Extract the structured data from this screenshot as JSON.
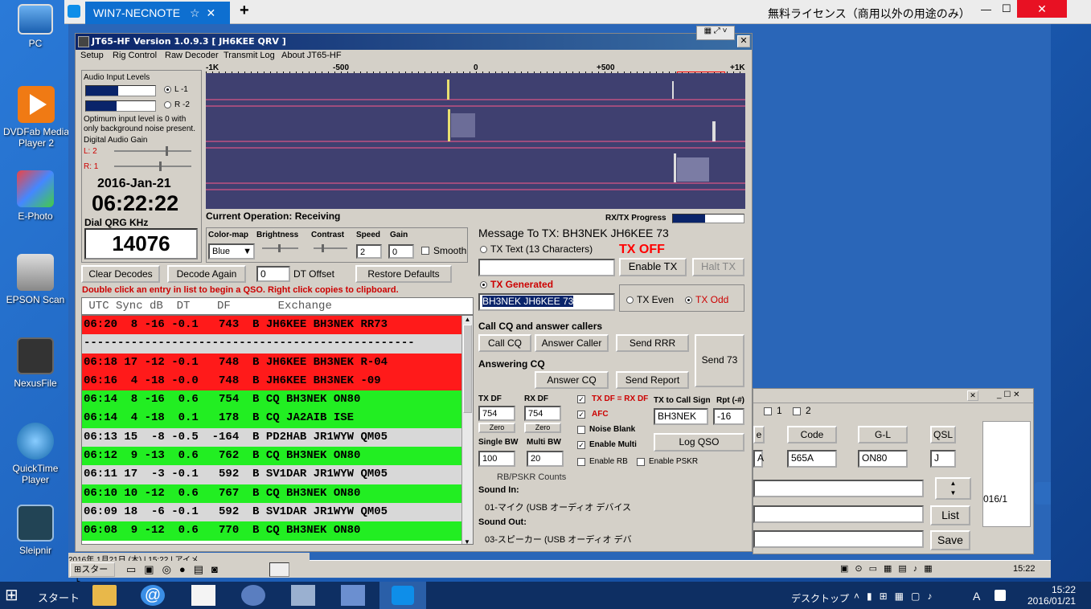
{
  "desktop_icons": [
    {
      "label": "PC",
      "icon": "pc-icon"
    },
    {
      "label": "DVDFab Media Player 2",
      "icon": "dvdfab-icon"
    },
    {
      "label": "E-Photo",
      "icon": "ephoto-icon"
    },
    {
      "label": "EPSON Scan",
      "icon": "epson-scan-icon"
    },
    {
      "label": "NexusFile",
      "icon": "nexusfile-icon"
    },
    {
      "label": "QuickTime Player",
      "icon": "quicktime-icon"
    },
    {
      "label": "Sleipnir",
      "icon": "sleipnir-icon"
    }
  ],
  "tv": {
    "tab": "WIN7-NECNOTE",
    "license": "無料ライセンス（商用以外の用途のみ）"
  },
  "jt": {
    "title": "JT65-HF Version 1.0.9.3  [ JH6KEE QRV ]",
    "menu": [
      "Setup",
      "Rig Control",
      "Raw Decoder",
      "Transmit Log",
      "About JT65-HF"
    ],
    "audio_label": "Audio Input Levels",
    "ch_left": "L -1",
    "ch_right": "R -2",
    "optimum_text": "Optimum input level is 0 with only background noise present.",
    "digital_gain": "Digital Audio Gain",
    "l_gain": "L: 2",
    "r_gain": "R: 1",
    "date": "2016-Jan-21",
    "time": "06:22:22",
    "dial_label": "Dial QRG KHz",
    "dial_value": "14076",
    "scale": [
      "-1K",
      "-500",
      "0",
      "+500",
      "+1K"
    ],
    "current_op_label": "Current Operation:",
    "current_op": "Receiving",
    "progress_label": "RX/TX Progress",
    "progress_value": 0.45,
    "colormap_label": "Color-map",
    "colormap_value": "Blue",
    "brightness_label": "Brightness",
    "contrast_label": "Contrast",
    "speed_label": "Speed",
    "speed_value": "2",
    "gain_label": "Gain",
    "gain_value": "0",
    "smooth_label": "Smooth",
    "clear_decodes": "Clear Decodes",
    "decode_again": "Decode Again",
    "dt_offset_value": "0",
    "dt_offset_label": "DT Offset",
    "restore_defaults": "Restore Defaults",
    "hint": "Double click an entry in list to begin a QSO.  Right click copies to clipboard.",
    "decode_header": " UTC Sync dB  DT    DF       Exchange",
    "decodes": [
      {
        "text": "06:20  8 -16 -0.1   743  B JH6KEE BH3NEK RR73",
        "bg": "#ff1a1a"
      },
      {
        "text": "-------------------------------------------------",
        "bg": "#d8d8d8"
      },
      {
        "text": "06:18 17 -12 -0.1   748  B JH6KEE BH3NEK R-04",
        "bg": "#ff1a1a"
      },
      {
        "text": "06:16  4 -18 -0.0   748  B JH6KEE BH3NEK -09",
        "bg": "#ff1a1a"
      },
      {
        "text": "06:14  8 -16  0.6   754  B CQ BH3NEK ON80",
        "bg": "#22ee22"
      },
      {
        "text": "06:14  4 -18  0.1   178  B CQ JA2AIB ISE",
        "bg": "#22ee22"
      },
      {
        "text": "06:13 15  -8 -0.5  -164  B PD2HAB JR1WYW QM05",
        "bg": "#d8d8d8"
      },
      {
        "text": "06:12  9 -13  0.6   762  B CQ BH3NEK ON80",
        "bg": "#22ee22"
      },
      {
        "text": "06:11 17  -3 -0.1   592  B SV1DAR JR1WYW QM05",
        "bg": "#d8d8d8"
      },
      {
        "text": "06:10 10 -12  0.6   767  B CQ BH3NEK ON80",
        "bg": "#22ee22"
      },
      {
        "text": "06:09 18  -6 -0.1   592  B SV1DAR JR1WYW QM05",
        "bg": "#d8d8d8"
      },
      {
        "text": "06:08  9 -12  0.6   770  B CQ BH3NEK ON80",
        "bg": "#22ee22"
      }
    ],
    "msg_to_tx_label": "Message To TX:",
    "msg_to_tx": "BH3NEK JH6KEE 73",
    "tx_text_label": "TX Text (13 Characters)",
    "tx_off": "TX OFF",
    "enable_tx": "Enable TX",
    "halt_tx": "Halt TX",
    "tx_generated_label": "TX Generated",
    "tx_generated_value": "BH3NEK JH6KEE 73",
    "tx_even": "TX Even",
    "tx_odd": "TX Odd",
    "call_cq_section": "Call CQ and answer callers",
    "call_cq": "Call CQ",
    "answer_caller": "Answer Caller",
    "send_rrr": "Send RRR",
    "send_73": "Send 73",
    "answering_cq": "Answering CQ",
    "answer_cq": "Answer CQ",
    "send_report": "Send Report",
    "tx_df_label": "TX DF",
    "tx_df_value": "754",
    "rx_df_label": "RX DF",
    "rx_df_value": "754",
    "zero": "Zero",
    "single_bw_label": "Single BW",
    "single_bw_value": "100",
    "multi_bw_label": "Multi BW",
    "multi_bw_value": "20",
    "txdf_eq_rxdf": "TX DF = RX DF",
    "afc": "AFC",
    "noise_blank": "Noise Blank",
    "enable_multi": "Enable Multi",
    "enable_rb": "Enable RB",
    "enable_pskr": "Enable PSKR",
    "tx_to_call_label": "TX to Call Sign",
    "tx_to_call_value": "BH3NEK",
    "rpt_label": "Rpt (-#)",
    "rpt_value": "-16",
    "log_qso": "Log QSO",
    "rb_counts": "RB/PSKR Counts",
    "sound_in_label": "Sound In:",
    "sound_in": "01-マイク (USB オーディオ デバイス",
    "sound_out_label": "Sound Out:",
    "sound_out": "03-スピーカー (USB オーディオ デバ"
  },
  "w2": {
    "opt1": "1",
    "opt2": "2",
    "code_label": "Code",
    "gl_label": "G-L",
    "qsl_label": "QSL",
    "field_a": "A",
    "code_value": "565A",
    "gl_value": "ON80",
    "qsl_value": "J",
    "date_fragment": "016/1",
    "list_btn": "List",
    "save_btn": "Save"
  },
  "xp": {
    "start": "スタート",
    "clock": "15:22",
    "status_fragment": "2016年 1月21日 (木) | 15:22 | アイメ"
  },
  "win8": {
    "start": "スタート",
    "desktop_label": "デスクトップ",
    "ime": "A",
    "time": "15:22",
    "date": "2016/01/21"
  }
}
